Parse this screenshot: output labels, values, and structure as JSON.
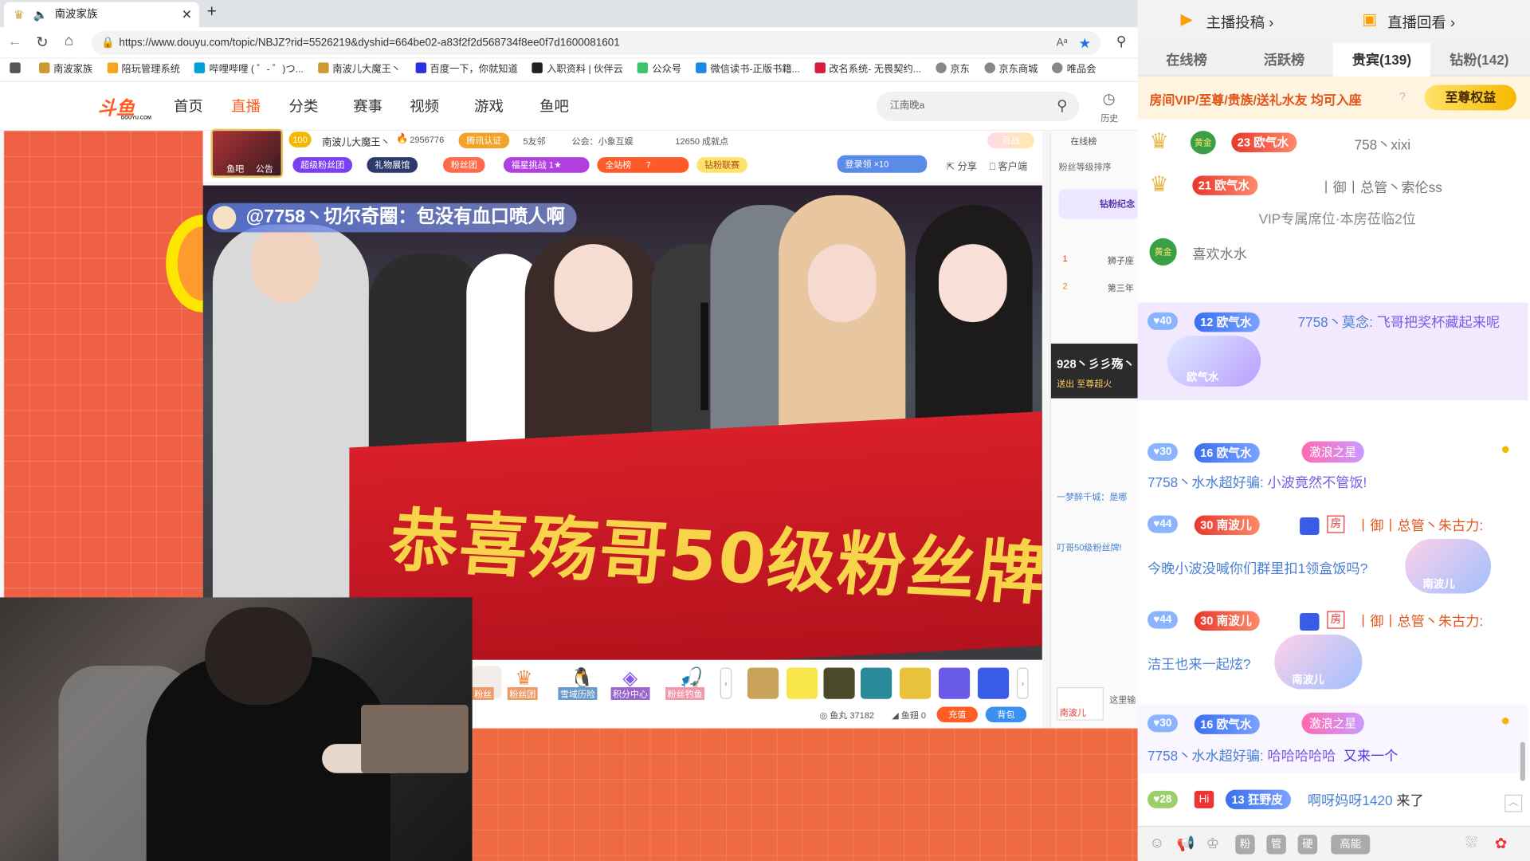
{
  "browser": {
    "tab_title": "南波家族",
    "url": "https://www.douyu.com/topic/NBJZ?rid=5526219&dyshid=664be02-a83f2f2d568734f8ee0f7d1600081601",
    "bookmarks": [
      "南波家族",
      "陪玩管理系统",
      "哔哩哔哩 ( ゜- ゜)つ...",
      "南波儿大魔王丶",
      "百度一下，你就知道",
      "入职资料 | 伙伴云",
      "公众号",
      "微信读书-正版书籍...",
      "改名系统- 无畏契约...",
      "京东",
      "京东商城",
      "唯品会"
    ]
  },
  "nav": {
    "logo": "斗鱼",
    "logo_sub": "DOUYU.COM",
    "items": [
      "首页",
      "直播",
      "分类",
      "赛事",
      "视频",
      "游戏",
      "鱼吧"
    ],
    "active": "直播",
    "search_placeholder": "江南晚a",
    "history": "历史"
  },
  "room": {
    "fish_bar": "鱼吧",
    "notice": "公告",
    "anchor": "南波儿大魔王丶",
    "hot": "2956776",
    "certified": "腾讯认证",
    "friends": "5友邻",
    "guild": "公会：小象互娱",
    "achievement": "12650 成就点",
    "baizhan": "百战",
    "tags": [
      "超级粉丝团",
      "礼物展馆",
      "粉丝团",
      "福星挑战",
      "全站榜",
      "钻粉联赛"
    ],
    "fuxing_count": "1",
    "rank_num": "7",
    "login_reward": "登录领",
    "login_count": "×10",
    "share": "分享",
    "client": "客户端"
  },
  "video": {
    "danmaku": "@7758丶切尔奇圈：包没有血口喷人啊",
    "banner": "恭喜殇哥50级粉丝牌！"
  },
  "gift": {
    "items": [
      "粉丝",
      "粉丝团",
      "雪域历险",
      "积分中心",
      "粉丝钓鱼"
    ],
    "fish_ball_label": "鱼丸",
    "fish_ball": "37182",
    "fish_wing_label": "鱼翅",
    "fish_wing": "0",
    "recharge": "充值",
    "backpack": "背包",
    "chat_placeholder": "这里输"
  },
  "rankcol": {
    "tab": "在线榜",
    "sort": "粉丝等级排序",
    "banner": "钻粉纪念",
    "ranks": [
      {
        "n": "1",
        "name": "狮子座"
      },
      {
        "n": "2",
        "name": "第三年"
      }
    ],
    "announce_name": "928丶彡彡殇丶",
    "announce_sub": "送出 至尊超火",
    "snippet1": "一梦醉千城：是哪",
    "snippet2": "叮哥50级粉丝牌!",
    "badge": "南波儿"
  },
  "chat": {
    "top_left": "主播投稿",
    "top_right": "直播回看",
    "tabs": [
      "在线榜",
      "活跃榜",
      "贵宾(139)",
      "钻粉(142)"
    ],
    "active_tab": "贵宾(139)",
    "vip_banner": "房间VIP/至尊/贵族/送礼水友 均可入座",
    "vip_banner_button": "至尊权益",
    "seats": [
      {
        "level": "23",
        "fan": "欧气水",
        "name": "758丶xixi"
      },
      {
        "level": "21",
        "fan": "欧气水",
        "name": "丨御丨总管丶索伦ss"
      }
    ],
    "seat_note": "VIP专属席位·本房莅临2位",
    "seat3_name": "喜欢水水",
    "messages": [
      {
        "vip": "40",
        "lvl": "12",
        "fan": "欧气水",
        "user": "7758丶莫念:",
        "text": "飞哥把奖杯藏起来呢",
        "card": "欧气水"
      },
      {
        "vip": "30",
        "lvl": "16",
        "fan": "欧气水",
        "medal": "激浪之星",
        "user": "7758丶水水超好骗:",
        "text": "小波竟然不管饭!"
      },
      {
        "vip": "44",
        "lvl": "30",
        "fan": "南波儿",
        "room": "房",
        "user": "丨御丨总管丶朱古力:",
        "text": "今晚小波没喊你们群里扣1领盒饭吗?",
        "card": "南波儿"
      },
      {
        "vip": "44",
        "lvl": "30",
        "fan": "南波儿",
        "room": "房",
        "user": "丨御丨总管丶朱古力:",
        "text": "洁王也来一起炫?",
        "card": "南波儿"
      },
      {
        "vip": "30",
        "lvl": "16",
        "fan": "欧气水",
        "medal": "激浪之星",
        "user": "7758丶水水超好骗:",
        "text": "哈哈哈哈哈",
        "extra": "又来一个"
      },
      {
        "vip": "28",
        "lvl": "13",
        "fan": "狂野皮",
        "hi": "Hi",
        "user": "啊呀妈呀1420",
        "text": "来了"
      }
    ],
    "bottom_icons": [
      "粉",
      "管",
      "硬",
      "高能"
    ],
    "colors": {
      "accent": "#ff5d23",
      "fan_blue": "#3a6ff0",
      "vip_gold": "#f5b800"
    }
  }
}
